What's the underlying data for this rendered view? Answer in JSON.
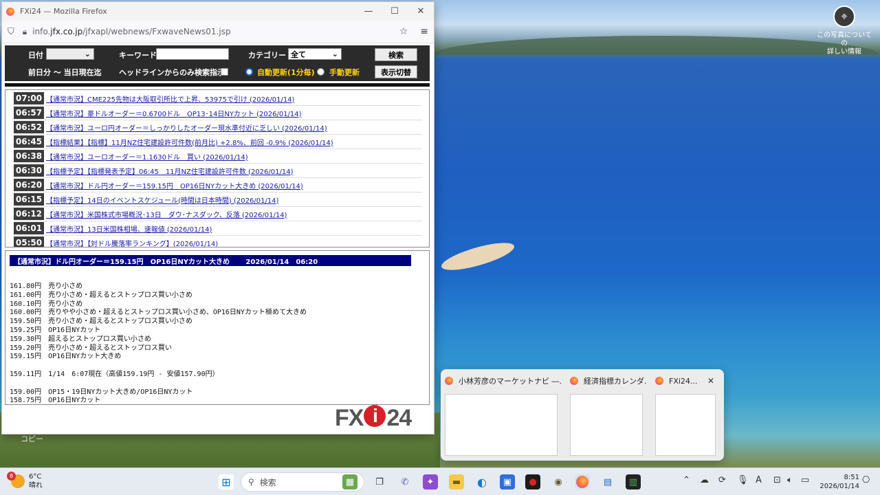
{
  "desktop": {
    "info_label_line1": "この写真についての",
    "info_label_line2": "詳しい情報",
    "watermark": "コピー"
  },
  "window": {
    "title": "FXi24 — Mozilla Firefox",
    "url_prefix": "info.",
    "url_host": "jfx.co.jp",
    "url_path": "/jfxapl/webnews/FxwaveNews01.jsp"
  },
  "controls": {
    "date_label": "日付",
    "keyword_label": "キーワード",
    "keyword_value": "",
    "category_label": "カテゴリー",
    "category_value": "全て",
    "search_button": "検索",
    "period_label": "前日分 〜 当日現在迄",
    "headline_only_label": "ヘッドラインからのみ検索指示",
    "auto_update_label": "自動更新(1分毎)",
    "manual_update_label": "手動更新",
    "toggle_button": "表示切替"
  },
  "news": [
    {
      "time": "07:00",
      "headline": "【通常市況】CME225先物は大阪取引所比で上昇、53975で引け (2026/01/14)"
    },
    {
      "time": "06:57",
      "headline": "【通常市況】豪ドルオーダー＝0.6700ドル　OP13･14日NYカット (2026/01/14)"
    },
    {
      "time": "06:52",
      "headline": "【通常市況】ユーロ円オーダー＝しっかりしたオーダー現水準付近に乏しい (2026/01/14)"
    },
    {
      "time": "06:45",
      "headline": "【指標結果】【指標】11月NZ住宅建設許可件数(前月比) +2.8%、前回 -0.9% (2026/01/14)"
    },
    {
      "time": "06:38",
      "headline": "【通常市況】ユーロオーダー＝1.1630ドル　買い (2026/01/14)"
    },
    {
      "time": "06:30",
      "headline": "【指標予定】【指標発表予定】06:45　11月NZ住宅建設許可件数 (2026/01/14)"
    },
    {
      "time": "06:20",
      "headline": "【通常市況】ドル円オーダー＝159.15円　OP16日NYカット大きめ (2026/01/14)"
    },
    {
      "time": "06:15",
      "headline": "【指標予定】14日のイベントスケジュール(時間は日本時間) (2026/01/14)"
    },
    {
      "time": "06:12",
      "headline": "【通常市況】米国株式市場概況･13日　ダウ･ナスダック、反落 (2026/01/14)"
    },
    {
      "time": "06:01",
      "headline": "【通常市況】13日米国株相場、速報値 (2026/01/14)"
    },
    {
      "time": "05:50",
      "headline": "【通常市況】【対ドル騰落率ランキング】(2026/01/14)"
    }
  ],
  "detail": {
    "header": "【通常市況】ドル円オーダー＝159.15円　OP16日NYカット大きめ　　 2026/01/14　06:20",
    "lines": [
      "161.80円　売り小さめ",
      "161.00円　売り小さめ・超えるとストップロス買い小さめ",
      "160.10円　売り小さめ",
      "160.00円　売りやや小さめ・超えるとストップロス買い小さめ、OP16日NYカット極めて大きめ",
      "159.50円　売り小さめ・超えるとストップロス買い小さめ",
      "159.25円　OP16日NYカット",
      "159.30円　超えるとストップロス買い小さめ",
      "159.20円　売り小さめ・超えるとストップロス買い",
      "159.15円　OP16日NYカット大きめ",
      "",
      "159.11円　1/14　6:07現在（高値159.19円 - 安値157.90円）",
      "",
      "159.00円　OP15・19日NYカット大きめ/OP16日NYカット",
      "158.75円　OP16日NYカット"
    ],
    "logo_left": "FX",
    "logo_i": "i",
    "logo_right": "24"
  },
  "thumbnails": [
    {
      "title": "小林芳彦のマーケットナビ ―..."
    },
    {
      "title": "経済指標カレンダ..."
    },
    {
      "title": "FXi24..."
    }
  ],
  "thumbnail_close": "✕",
  "taskbar": {
    "temperature": "6°C",
    "condition": "晴れ",
    "weather_badge": "8",
    "search_placeholder": "検索",
    "time": "8:51",
    "date": "2026/01/14"
  }
}
